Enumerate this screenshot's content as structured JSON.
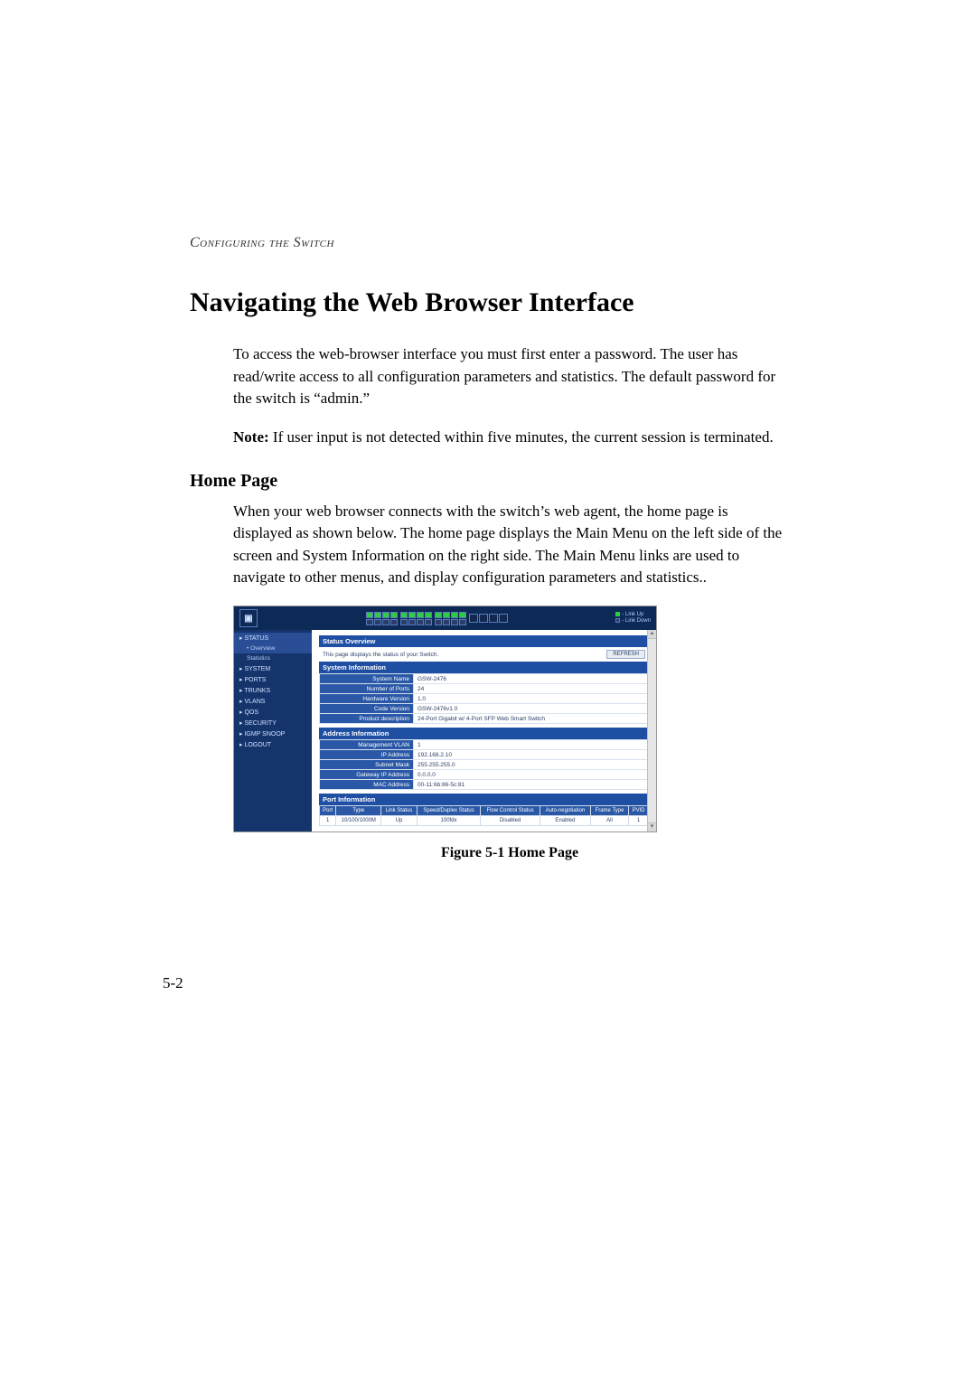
{
  "running_head": "Configuring the Switch",
  "section_title": "Navigating the Web Browser Interface",
  "intro_para": "To access the web-browser interface you must first enter a password. The user has read/write access to all configuration parameters and statistics. The default password for the switch is “admin.”",
  "note_label": "Note:",
  "note_text": "  If user input is not detected within five minutes, the current session is terminated.",
  "subhead": "Home Page",
  "subhead_para": "When your web browser connects with the switch’s web agent, the home page is displayed as shown below. The home page displays the Main Menu on the left side of the screen and System Information on the right side. The Main Menu links are used to navigate to other menus, and display configuration parameters and statistics..",
  "figure_caption": "Figure 5-1  Home Page",
  "page_number": "5-2",
  "screenshot": {
    "legend_up": "- Link Up",
    "legend_down": "- Link Down",
    "sidebar": {
      "items": [
        {
          "label": "STATUS",
          "sel": true
        },
        {
          "label": "Overview",
          "sub": true,
          "sel": true
        },
        {
          "label": "Statistics",
          "sub": true
        },
        {
          "label": "SYSTEM"
        },
        {
          "label": "PORTS"
        },
        {
          "label": "TRUNKS"
        },
        {
          "label": "VLANS"
        },
        {
          "label": "QOS"
        },
        {
          "label": "SECURITY"
        },
        {
          "label": "IGMP SNOOP"
        },
        {
          "label": "LOGOUT"
        }
      ]
    },
    "status_overview_title": "Status Overview",
    "status_overview_sub": "This page displays the status of your Switch.",
    "refresh_label": "REFRESH",
    "system_info_title": "System Information",
    "system_info": [
      {
        "k": "System Name",
        "v": "GSW-2476"
      },
      {
        "k": "Number of Ports",
        "v": "24"
      },
      {
        "k": "Hardware Version",
        "v": "1.0"
      },
      {
        "k": "Code Version",
        "v": "GSW-2476v1.0"
      },
      {
        "k": "Product description",
        "v": "24-Port Gigabit w/ 4-Port SFP Web Smart Switch"
      }
    ],
    "address_info_title": "Address Information",
    "address_info": [
      {
        "k": "Management VLAN",
        "v": "1"
      },
      {
        "k": "IP Address",
        "v": "192.168.2.10"
      },
      {
        "k": "Subnet Mask",
        "v": "255.255.255.0"
      },
      {
        "k": "Gateway IP Address",
        "v": "0.0.0.0"
      },
      {
        "k": "MAC Address",
        "v": "00-11:6b:86-5c:81"
      }
    ],
    "port_info_title": "Port Information",
    "port_headers": [
      "Port",
      "Type",
      "Link Status",
      "Speed/Duplex Status",
      "Flow Control Status",
      "Auto-negotiation",
      "Frame Type",
      "PVID"
    ],
    "port_row": [
      "1",
      "10/100/1000M",
      "Up",
      "100fdx",
      "Disabled",
      "Enabled",
      "All",
      "1"
    ]
  }
}
